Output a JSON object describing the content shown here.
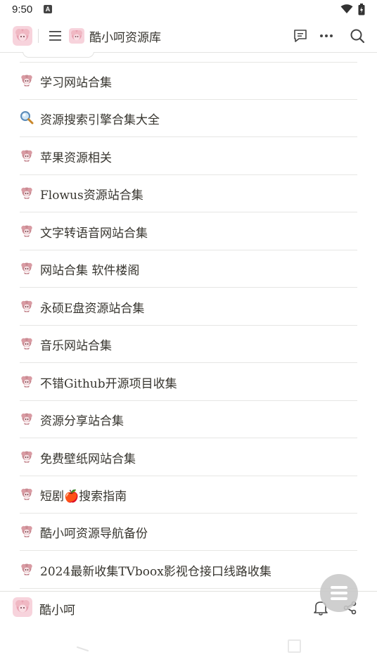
{
  "status": {
    "time": "9:50",
    "indicator": "A"
  },
  "header": {
    "title": "酷小呵资源库",
    "icons": [
      "menu-icon",
      "comment-icon",
      "more-icon",
      "search-icon"
    ]
  },
  "items": [
    {
      "label": "学习网站合集",
      "icon": "doll-icon"
    },
    {
      "label": "资源搜索引擎合集大全",
      "icon": "magnifier-icon"
    },
    {
      "label": "苹果资源相关",
      "icon": "doll-icon"
    },
    {
      "label": "Flowus资源站合集",
      "icon": "doll-icon"
    },
    {
      "label": "文字转语音网站合集",
      "icon": "doll-icon"
    },
    {
      "label": "网站合集 软件楼阁",
      "icon": "doll-icon"
    },
    {
      "label": "永硕E盘资源站合集",
      "icon": "doll-icon"
    },
    {
      "label": "音乐网站合集",
      "icon": "doll-icon"
    },
    {
      "label": "不错Github开源项目收集",
      "icon": "doll-icon"
    },
    {
      "label": "资源分享站合集",
      "icon": "doll-icon"
    },
    {
      "label": "免费壁纸网站合集",
      "icon": "doll-icon"
    },
    {
      "label": "短剧🍎搜索指南",
      "icon": "doll-icon"
    },
    {
      "label": "酷小呵资源导航备份",
      "icon": "doll-icon"
    },
    {
      "label": "2024最新收集TVboox影视仓接口线路收集",
      "icon": "doll-icon"
    }
  ],
  "footer": {
    "author": "酷小呵"
  },
  "colors": {
    "text": "#37352f",
    "divider": "#e6e6e4",
    "doll": "#c98a92",
    "fab": "#c8c8c8"
  }
}
